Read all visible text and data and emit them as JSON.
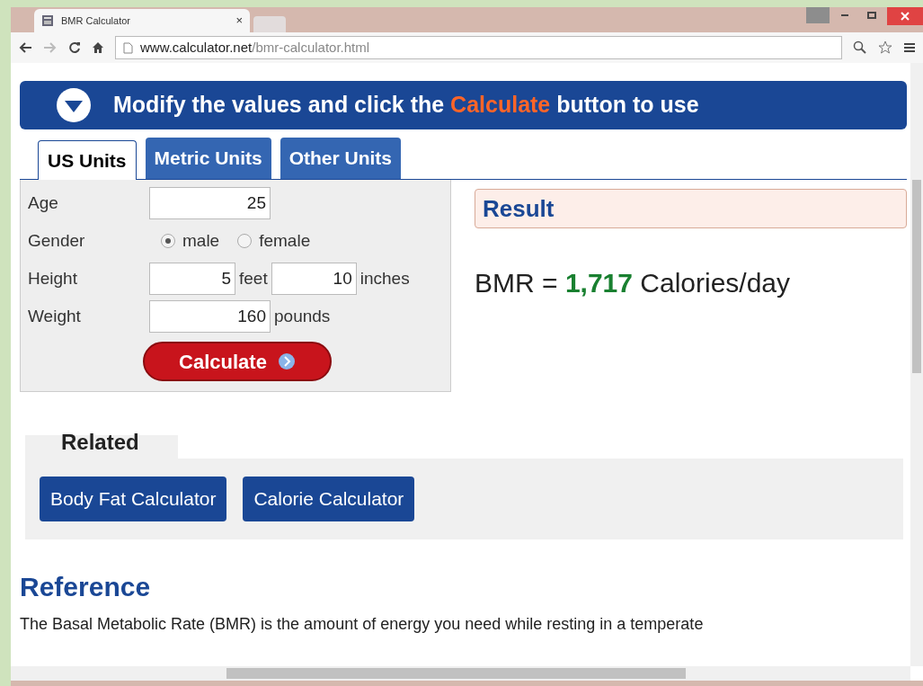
{
  "browser": {
    "tab_title": "BMR Calculator",
    "tab_close": "×",
    "url_host": "www.calculator.net",
    "url_path": "/bmr-calculator.html"
  },
  "banner": {
    "text_before": "Modify the values and click the",
    "highlight": "Calculate",
    "text_after": "button to use"
  },
  "tabs": [
    {
      "label": "US Units",
      "selected": true
    },
    {
      "label": "Metric Units",
      "selected": false
    },
    {
      "label": "Other Units",
      "selected": false
    }
  ],
  "form": {
    "age": {
      "label": "Age",
      "value": "25"
    },
    "gender": {
      "label": "Gender",
      "options": [
        {
          "label": "male",
          "selected": true
        },
        {
          "label": "female",
          "selected": false
        }
      ]
    },
    "height": {
      "label": "Height",
      "feet": "5",
      "feet_unit": "feet",
      "inches": "10",
      "inches_unit": "inches"
    },
    "weight": {
      "label": "Weight",
      "value": "160",
      "unit": "pounds"
    },
    "button": "Calculate"
  },
  "result": {
    "heading": "Result",
    "prefix": "BMR =",
    "value": "1,717",
    "suffix": "Calories/day"
  },
  "related": {
    "heading": "Related",
    "links": [
      "Body Fat Calculator",
      "Calorie Calculator"
    ]
  },
  "reference": {
    "heading": "Reference",
    "text": "The Basal Metabolic Rate (BMR) is the amount of energy you need while resting in a temperate"
  }
}
